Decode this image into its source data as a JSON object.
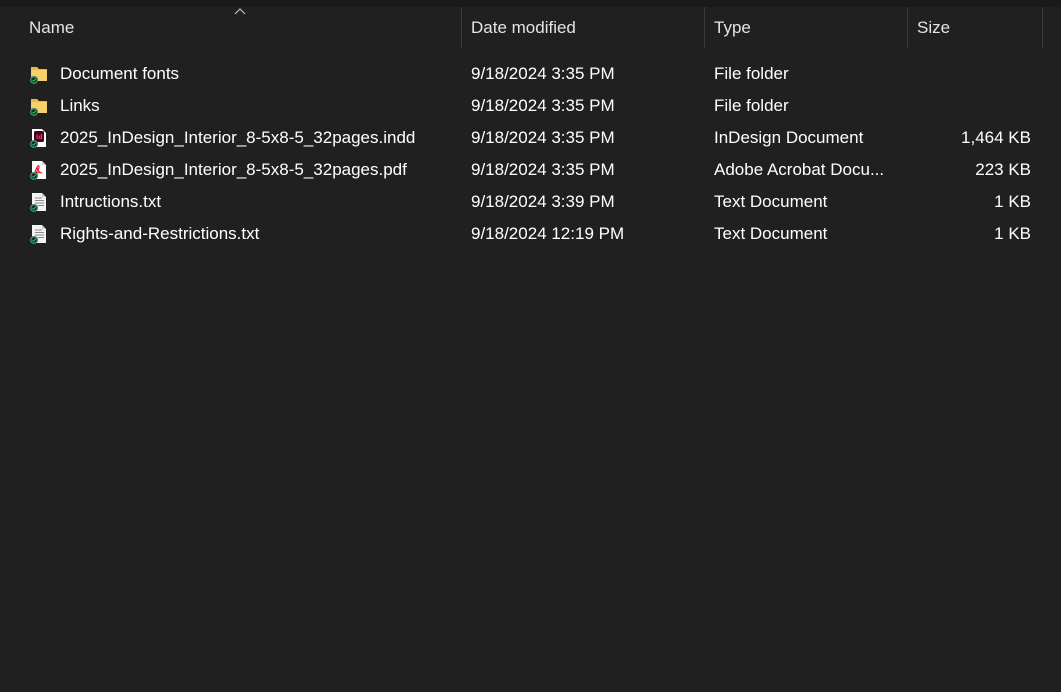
{
  "columns": {
    "name": "Name",
    "date": "Date modified",
    "type": "Type",
    "size": "Size"
  },
  "files": [
    {
      "name": "Document fonts",
      "date": "9/18/2024 3:35 PM",
      "type": "File folder",
      "size": "",
      "icon": "folder-icon"
    },
    {
      "name": "Links",
      "date": "9/18/2024 3:35 PM",
      "type": "File folder",
      "size": "",
      "icon": "folder-icon"
    },
    {
      "name": "2025_InDesign_Interior_8-5x8-5_32pages.indd",
      "date": "9/18/2024 3:35 PM",
      "type": "InDesign Document",
      "size": "1,464 KB",
      "icon": "indesign-file-icon"
    },
    {
      "name": "2025_InDesign_Interior_8-5x8-5_32pages.pdf",
      "date": "9/18/2024 3:35 PM",
      "type": "Adobe Acrobat Docu...",
      "size": "223 KB",
      "icon": "pdf-file-icon"
    },
    {
      "name": "Intructions.txt",
      "date": "9/18/2024 3:39 PM",
      "type": "Text Document",
      "size": "1 KB",
      "icon": "text-file-icon"
    },
    {
      "name": "Rights-and-Restrictions.txt",
      "date": "9/18/2024 12:19 PM",
      "type": "Text Document",
      "size": "1 KB",
      "icon": "text-file-icon"
    }
  ],
  "colors": {
    "background": "#202020",
    "folder": "#f2c95c",
    "sync_check": "#2ea36b",
    "indesign": "#ff3366",
    "pdf": "#e3252f"
  }
}
